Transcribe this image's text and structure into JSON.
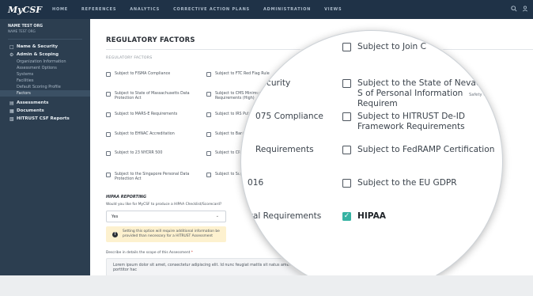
{
  "topnav": {
    "logo": "MyCSF",
    "links": [
      "HOME",
      "REFERENCES",
      "ANALYTICS",
      "CORRECTIVE ACTION PLANS",
      "ADMINISTRATION",
      "VIEWS"
    ]
  },
  "sidebar": {
    "org_name": "NAME TEST ORG",
    "org_sub": "NAME TEST ORG",
    "items": {
      "name_security": "Name & Security",
      "admin_scoping": "Admin & Scoping",
      "sub": [
        "Organization Information",
        "Assessment Options",
        "Systems",
        "Facilities",
        "Default Scoring Profile",
        "Factors"
      ],
      "assessments": "Assessments",
      "documents": "Documents",
      "reports": "HITRUST CSF Reports"
    }
  },
  "main": {
    "title": "REGULATORY FACTORS",
    "section_label": "REGULATORY FACTORS",
    "col1": [
      "Subject to FISMA Compliance",
      "Subject to State of Massachusetts Data Protection Act",
      "Subject to MARS-E Requirements",
      "Subject to EHNAC Accreditation",
      "Subject to 23 NYCRR 500",
      "Subject to the Singapore Personal Data Protection Act"
    ],
    "col2": [
      "Subject to FTC Red Flag Rule",
      "Subject to CMS Minimum Security Requirements (High)",
      "Subject to IRS Pub 1075 Compliance",
      "Subject to Banking",
      "Subject to CRR",
      "Subject to Supplemental"
    ],
    "hipaa_heading": "HIPAA REPORTING",
    "hipaa_question": "Would you like for MyCSF to produce a HIPAA Checklist/Scorecard?",
    "hipaa_value": "Yes",
    "warning": "Setting this option will require additional information be provided than necessary for a HITRUST Assessment",
    "desc_label": "Describe in details the scope of this Assessment",
    "desc_required": "*",
    "desc_value": "Lorem ipsum dolor sit amet, consectetur adipiscing elit. Id nunc feugiat mattis sit natus amet porttitor hac"
  },
  "magnifier": {
    "top_partial": "Subject to Join C",
    "left_fragments": [
      "curity",
      "075 Compliance",
      "Requirements",
      "016",
      "ntal Requirements"
    ],
    "items": [
      "Subject to the State of Nevada S of Personal Information Requirem",
      "Subject to HITRUST De-ID Framework Requirements",
      "Subject to FedRAMP Certification",
      "Subject to the EU GDPR"
    ],
    "checked_item": "HIPAA",
    "tiny_right": [
      "Flag Rule",
      "Safety Code"
    ]
  },
  "colors": {
    "nav_bg": "#1f3247",
    "sidebar_bg": "#2c3e50",
    "check_accent": "#36b3a3",
    "warning_bg": "#fdf1cf"
  }
}
